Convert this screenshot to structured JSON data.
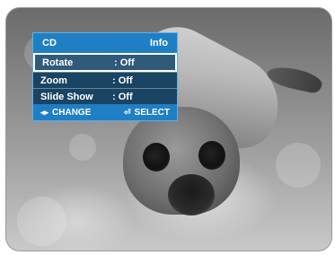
{
  "menu": {
    "title": "CD",
    "right_title": "Info",
    "items": [
      {
        "label": "Rotate",
        "value": ": Off"
      },
      {
        "label": "Zoom",
        "value": ": Off"
      },
      {
        "label": "Slide Show",
        "value": ": Off"
      }
    ],
    "selected_index": 0,
    "footer": {
      "change_label": "CHANGE",
      "select_label": "SELECT"
    }
  },
  "icons": {
    "change": "left-right-arrows-icon",
    "select": "enter-icon"
  },
  "colors": {
    "menu_blue": "#1f7fc4",
    "text": "#ffffff"
  }
}
